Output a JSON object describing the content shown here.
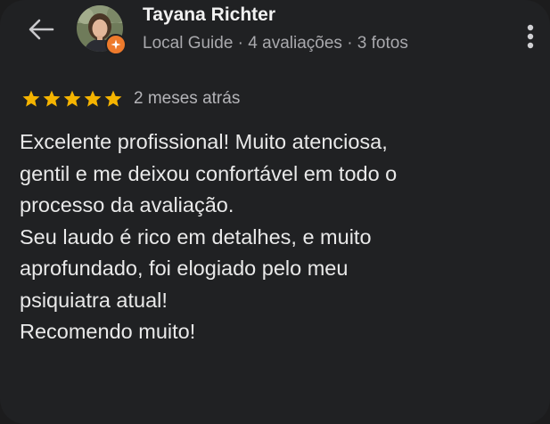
{
  "review": {
    "author_name": "Tayana Richter",
    "author_meta": "Local Guide · 4 avaliações · 3 fotos",
    "rating": 5,
    "rating_max": 5,
    "time_ago": "2 meses atrás",
    "text": "Excelente profissional! Muito atenciosa,\ngentil e me deixou confortável em todo o\nprocesso da avaliação.\nSeu laudo é rico em detalhes, e muito\naprofundado, foi elogiado pelo meu\npsiquiatra atual!\nRecomendo muito!"
  },
  "icons": {
    "back": "arrow-left-icon",
    "more": "more-vertical-icon",
    "badge": "local-guide-badge-icon",
    "star": "star-icon"
  },
  "colors": {
    "background": "#202123",
    "star": "#f5b400",
    "badge": "#ee7a2c",
    "secondary_text": "#a9a9ad"
  }
}
